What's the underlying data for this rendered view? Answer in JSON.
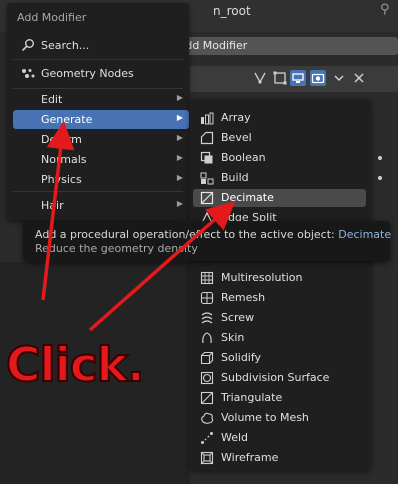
{
  "background": {
    "header_text": "n_root",
    "add_modifier_button": "Add Modifier",
    "toolbar_icons": [
      "vertex-icon",
      "edit-mode-icon",
      "realtime-icon",
      "render-icon",
      "chevron-down-icon",
      "close-icon"
    ]
  },
  "menu": {
    "title": "Add Modifier",
    "search_label": "Search...",
    "geometry_nodes_label": "Geometry Nodes",
    "categories": [
      {
        "label": "Edit",
        "active": false
      },
      {
        "label": "Generate",
        "active": true
      },
      {
        "label": "Deform",
        "active": false
      },
      {
        "label": "Normals",
        "active": false
      },
      {
        "label": "Physics",
        "active": false
      },
      {
        "label": "Hair",
        "active": false
      }
    ]
  },
  "submenu": {
    "items": [
      {
        "label": "Array",
        "icon": "array-icon"
      },
      {
        "label": "Bevel",
        "icon": "bevel-icon"
      },
      {
        "label": "Boolean",
        "icon": "boolean-icon"
      },
      {
        "label": "Build",
        "icon": "build-icon"
      },
      {
        "label": "Decimate",
        "icon": "decimate-icon",
        "highlighted": true
      },
      {
        "label": "Edge Split",
        "icon": "edge-split-icon"
      },
      {
        "label": "Multiresolution",
        "icon": "multiresolution-icon"
      },
      {
        "label": "Remesh",
        "icon": "remesh-icon"
      },
      {
        "label": "Screw",
        "icon": "screw-icon"
      },
      {
        "label": "Skin",
        "icon": "skin-icon"
      },
      {
        "label": "Solidify",
        "icon": "solidify-icon"
      },
      {
        "label": "Subdivision Surface",
        "icon": "subdivision-surface-icon"
      },
      {
        "label": "Triangulate",
        "icon": "triangulate-icon"
      },
      {
        "label": "Volume to Mesh",
        "icon": "volume-to-mesh-icon"
      },
      {
        "label": "Weld",
        "icon": "weld-icon"
      },
      {
        "label": "Wireframe",
        "icon": "wireframe-icon"
      }
    ]
  },
  "tooltip": {
    "line1": "Add a procedural operation/effect to the active object:",
    "line1_value": "Decimate",
    "line2": "Reduce the geometry density"
  },
  "annotation": {
    "text": "Click.",
    "color": "#e3191b"
  },
  "colors": {
    "accent": "#4772b3",
    "menu_bg": "#1f1f1f",
    "tooltip_value": "#8fb3e3"
  }
}
